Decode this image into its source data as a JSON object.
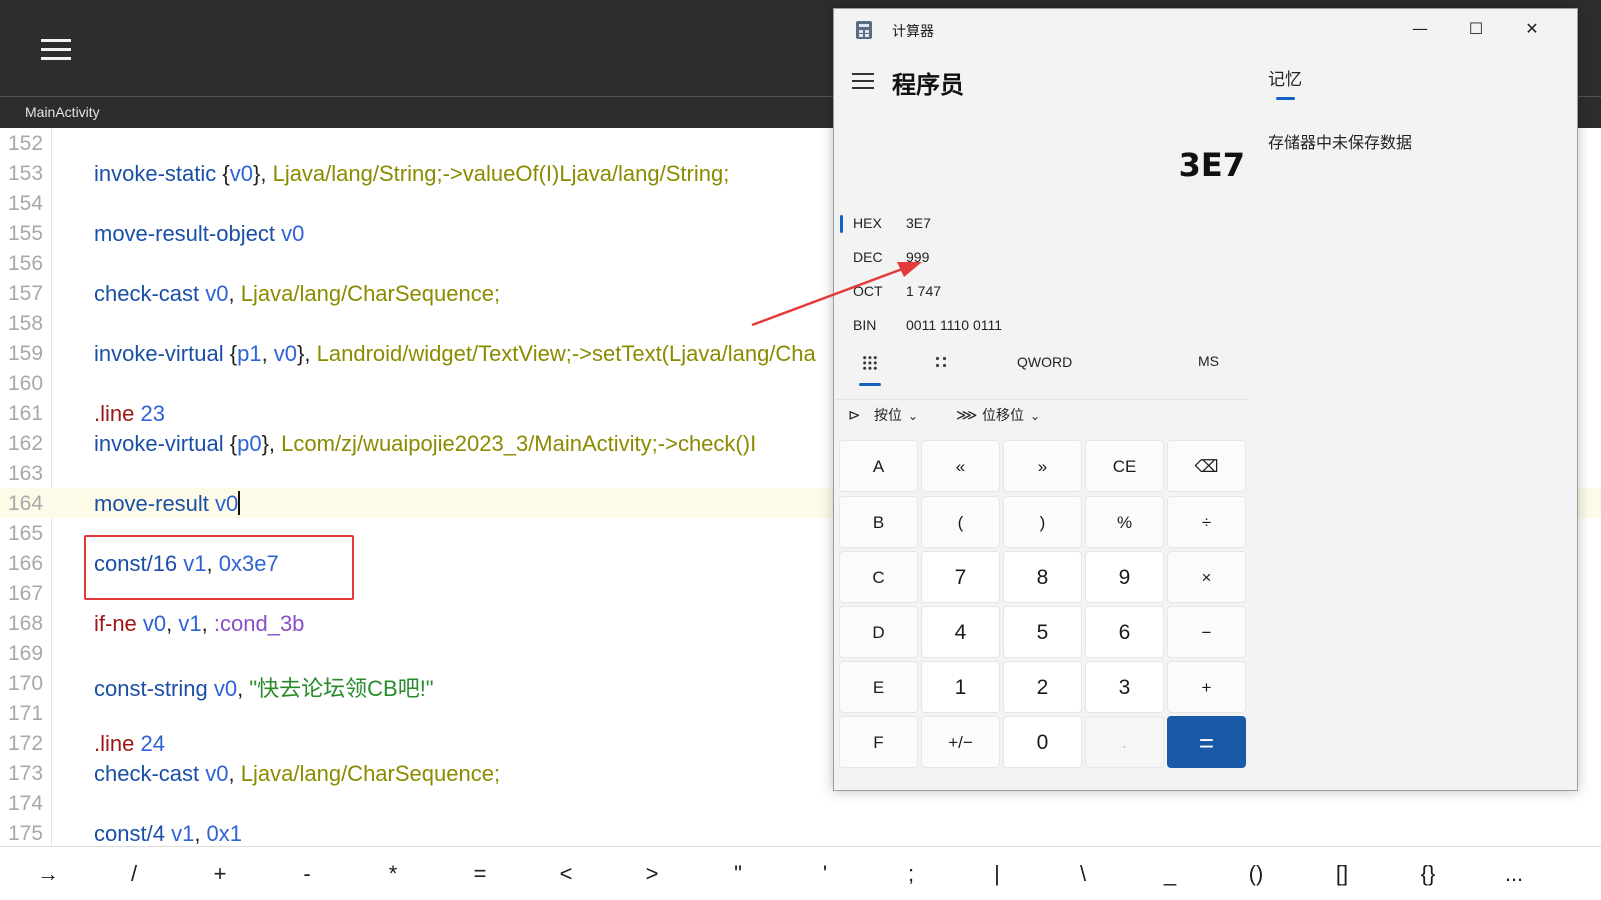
{
  "editor": {
    "tab_title": "MainActivity",
    "tab_right_fragment": ")",
    "lines": [
      {
        "num": "152",
        "tokens": []
      },
      {
        "num": "153",
        "tokens": [
          [
            "kw",
            "invoke-static"
          ],
          [
            "pun",
            " {"
          ],
          [
            "reg",
            "v0"
          ],
          [
            "pun",
            "}, "
          ],
          [
            "type",
            "Ljava/lang/String;->valueOf(I)Ljava/lang/String;"
          ]
        ]
      },
      {
        "num": "154",
        "tokens": []
      },
      {
        "num": "155",
        "tokens": [
          [
            "kw",
            "move-result-object"
          ],
          [
            "pun",
            " "
          ],
          [
            "reg",
            "v0"
          ]
        ]
      },
      {
        "num": "156",
        "tokens": []
      },
      {
        "num": "157",
        "tokens": [
          [
            "kw",
            "check-cast"
          ],
          [
            "pun",
            " "
          ],
          [
            "reg",
            "v0"
          ],
          [
            "pun",
            ", "
          ],
          [
            "type",
            "Ljava/lang/CharSequence;"
          ]
        ]
      },
      {
        "num": "158",
        "tokens": []
      },
      {
        "num": "159",
        "tokens": [
          [
            "kw",
            "invoke-virtual"
          ],
          [
            "pun",
            " {"
          ],
          [
            "reg",
            "p1"
          ],
          [
            "pun",
            ", "
          ],
          [
            "reg",
            "v0"
          ],
          [
            "pun",
            "}, "
          ],
          [
            "type",
            "Landroid/widget/TextView;->setText(Ljava/lang/Cha"
          ]
        ]
      },
      {
        "num": "160",
        "tokens": []
      },
      {
        "num": "161",
        "tokens": [
          [
            "dir",
            ".line"
          ],
          [
            "pun",
            " "
          ],
          [
            "reg",
            "23"
          ]
        ]
      },
      {
        "num": "162",
        "tokens": [
          [
            "kw",
            "invoke-virtual"
          ],
          [
            "pun",
            " {"
          ],
          [
            "reg",
            "p0"
          ],
          [
            "pun",
            "}, "
          ],
          [
            "type",
            "Lcom/zj/wuaipojie2023_3/MainActivity;->check()I"
          ]
        ]
      },
      {
        "num": "163",
        "tokens": []
      },
      {
        "num": "164",
        "tokens": [
          [
            "kw",
            "move-result"
          ],
          [
            "pun",
            " "
          ],
          [
            "reg",
            "v0"
          ]
        ],
        "current": true
      },
      {
        "num": "165",
        "tokens": []
      },
      {
        "num": "166",
        "tokens": [
          [
            "kw",
            "const/16"
          ],
          [
            "pun",
            " "
          ],
          [
            "reg",
            "v1"
          ],
          [
            "pun",
            ", "
          ],
          [
            "reg",
            "0x3e7"
          ]
        ]
      },
      {
        "num": "167",
        "tokens": []
      },
      {
        "num": "168",
        "tokens": [
          [
            "dir",
            "if-ne"
          ],
          [
            "pun",
            " "
          ],
          [
            "reg",
            "v0"
          ],
          [
            "pun",
            ", "
          ],
          [
            "reg",
            "v1"
          ],
          [
            "pun",
            ", "
          ],
          [
            "lbl",
            ":cond_3b"
          ]
        ]
      },
      {
        "num": "169",
        "tokens": []
      },
      {
        "num": "170",
        "tokens": [
          [
            "kw",
            "const-string"
          ],
          [
            "pun",
            " "
          ],
          [
            "reg",
            "v0"
          ],
          [
            "pun",
            ", "
          ],
          [
            "str",
            "\"快去论坛领CB吧!\""
          ]
        ]
      },
      {
        "num": "171",
        "tokens": []
      },
      {
        "num": "172",
        "tokens": [
          [
            "dir",
            ".line"
          ],
          [
            "pun",
            " "
          ],
          [
            "reg",
            "24"
          ]
        ]
      },
      {
        "num": "173",
        "tokens": [
          [
            "kw",
            "check-cast"
          ],
          [
            "pun",
            " "
          ],
          [
            "reg",
            "v0"
          ],
          [
            "pun",
            ", "
          ],
          [
            "type",
            "Ljava/lang/CharSequence;"
          ]
        ]
      },
      {
        "num": "174",
        "tokens": []
      },
      {
        "num": "175",
        "tokens": [
          [
            "kw",
            "const/4"
          ],
          [
            "pun",
            " "
          ],
          [
            "reg",
            "v1"
          ],
          [
            "pun",
            ", "
          ],
          [
            "reg",
            "0x1"
          ]
        ]
      }
    ]
  },
  "symbols": [
    "→",
    "/",
    "+",
    "-",
    "*",
    "=",
    "<",
    ">",
    "\"",
    "'",
    ";",
    "|",
    "\\",
    "_",
    "()",
    "[]",
    "{}",
    "..."
  ],
  "calculator": {
    "title": "计算器",
    "mode": "程序员",
    "display": "3E7",
    "controls": {
      "minimize": "—",
      "maximize": "☐",
      "close": "✕"
    },
    "bases": [
      {
        "name": "HEX",
        "value": "3E7",
        "active": true
      },
      {
        "name": "DEC",
        "value": "999",
        "active": false
      },
      {
        "name": "OCT",
        "value": "1 747",
        "active": false
      },
      {
        "name": "BIN",
        "value": "0011 1110 0111",
        "active": false
      }
    ],
    "word_size": "QWORD",
    "ms": "MS",
    "bitwise_label": "按位",
    "bitshift_label": "位移位",
    "memory_header": "记忆",
    "memory_empty": "存储器中未保存数据",
    "keys": [
      [
        {
          "label": "A",
          "kind": "fn"
        },
        {
          "label": "«",
          "kind": "fn"
        },
        {
          "label": "»",
          "kind": "fn"
        },
        {
          "label": "CE",
          "kind": "fn"
        },
        {
          "label": "⌫",
          "kind": "fn"
        }
      ],
      [
        {
          "label": "B",
          "kind": "fn"
        },
        {
          "label": "(",
          "kind": "fn"
        },
        {
          "label": ")",
          "kind": "fn"
        },
        {
          "label": "%",
          "kind": "fn"
        },
        {
          "label": "÷",
          "kind": "fn"
        }
      ],
      [
        {
          "label": "C",
          "kind": "fn"
        },
        {
          "label": "7",
          "kind": "num"
        },
        {
          "label": "8",
          "kind": "num"
        },
        {
          "label": "9",
          "kind": "num"
        },
        {
          "label": "×",
          "kind": "fn"
        }
      ],
      [
        {
          "label": "D",
          "kind": "fn"
        },
        {
          "label": "4",
          "kind": "num"
        },
        {
          "label": "5",
          "kind": "num"
        },
        {
          "label": "6",
          "kind": "num"
        },
        {
          "label": "−",
          "kind": "fn"
        }
      ],
      [
        {
          "label": "E",
          "kind": "fn"
        },
        {
          "label": "1",
          "kind": "num"
        },
        {
          "label": "2",
          "kind": "num"
        },
        {
          "label": "3",
          "kind": "num"
        },
        {
          "label": "+",
          "kind": "fn"
        }
      ],
      [
        {
          "label": "F",
          "kind": "fn"
        },
        {
          "label": "+/−",
          "kind": "fn"
        },
        {
          "label": "0",
          "kind": "num"
        },
        {
          "label": ".",
          "kind": "dim"
        },
        {
          "label": "=",
          "kind": "eq"
        }
      ]
    ]
  },
  "colors": {
    "accent": "#1560c1",
    "annotation": "#e43a3a",
    "equals_key": "#1959a8"
  }
}
